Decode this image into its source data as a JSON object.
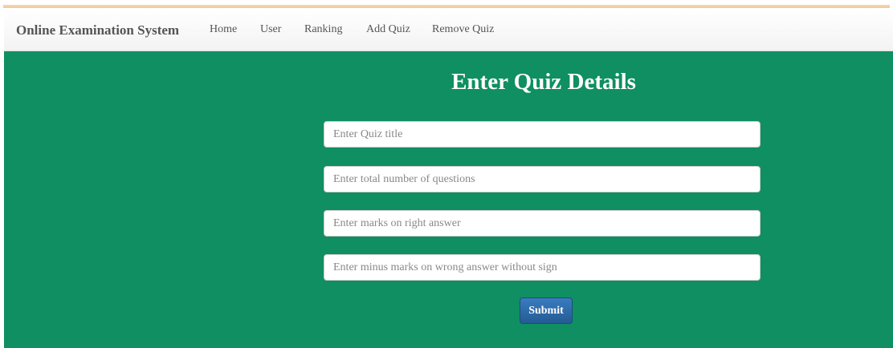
{
  "navbar": {
    "brand": "Online Examination System",
    "links": [
      "Home",
      "User",
      "Ranking",
      "Add Quiz",
      "Remove Quiz"
    ]
  },
  "form": {
    "title": "Enter Quiz Details",
    "fields": [
      {
        "value": "",
        "placeholder": "Enter Quiz title"
      },
      {
        "value": "",
        "placeholder": "Enter total number of questions"
      },
      {
        "value": "",
        "placeholder": "Enter marks on right answer"
      },
      {
        "value": "",
        "placeholder": "Enter minus marks on wrong answer without sign"
      }
    ],
    "submit_label": "Submit"
  },
  "colors": {
    "background": "#0f8f62",
    "navbar": "#f8f8f8",
    "button": "#2f6da9",
    "top_accent": "#f2cfa2"
  }
}
